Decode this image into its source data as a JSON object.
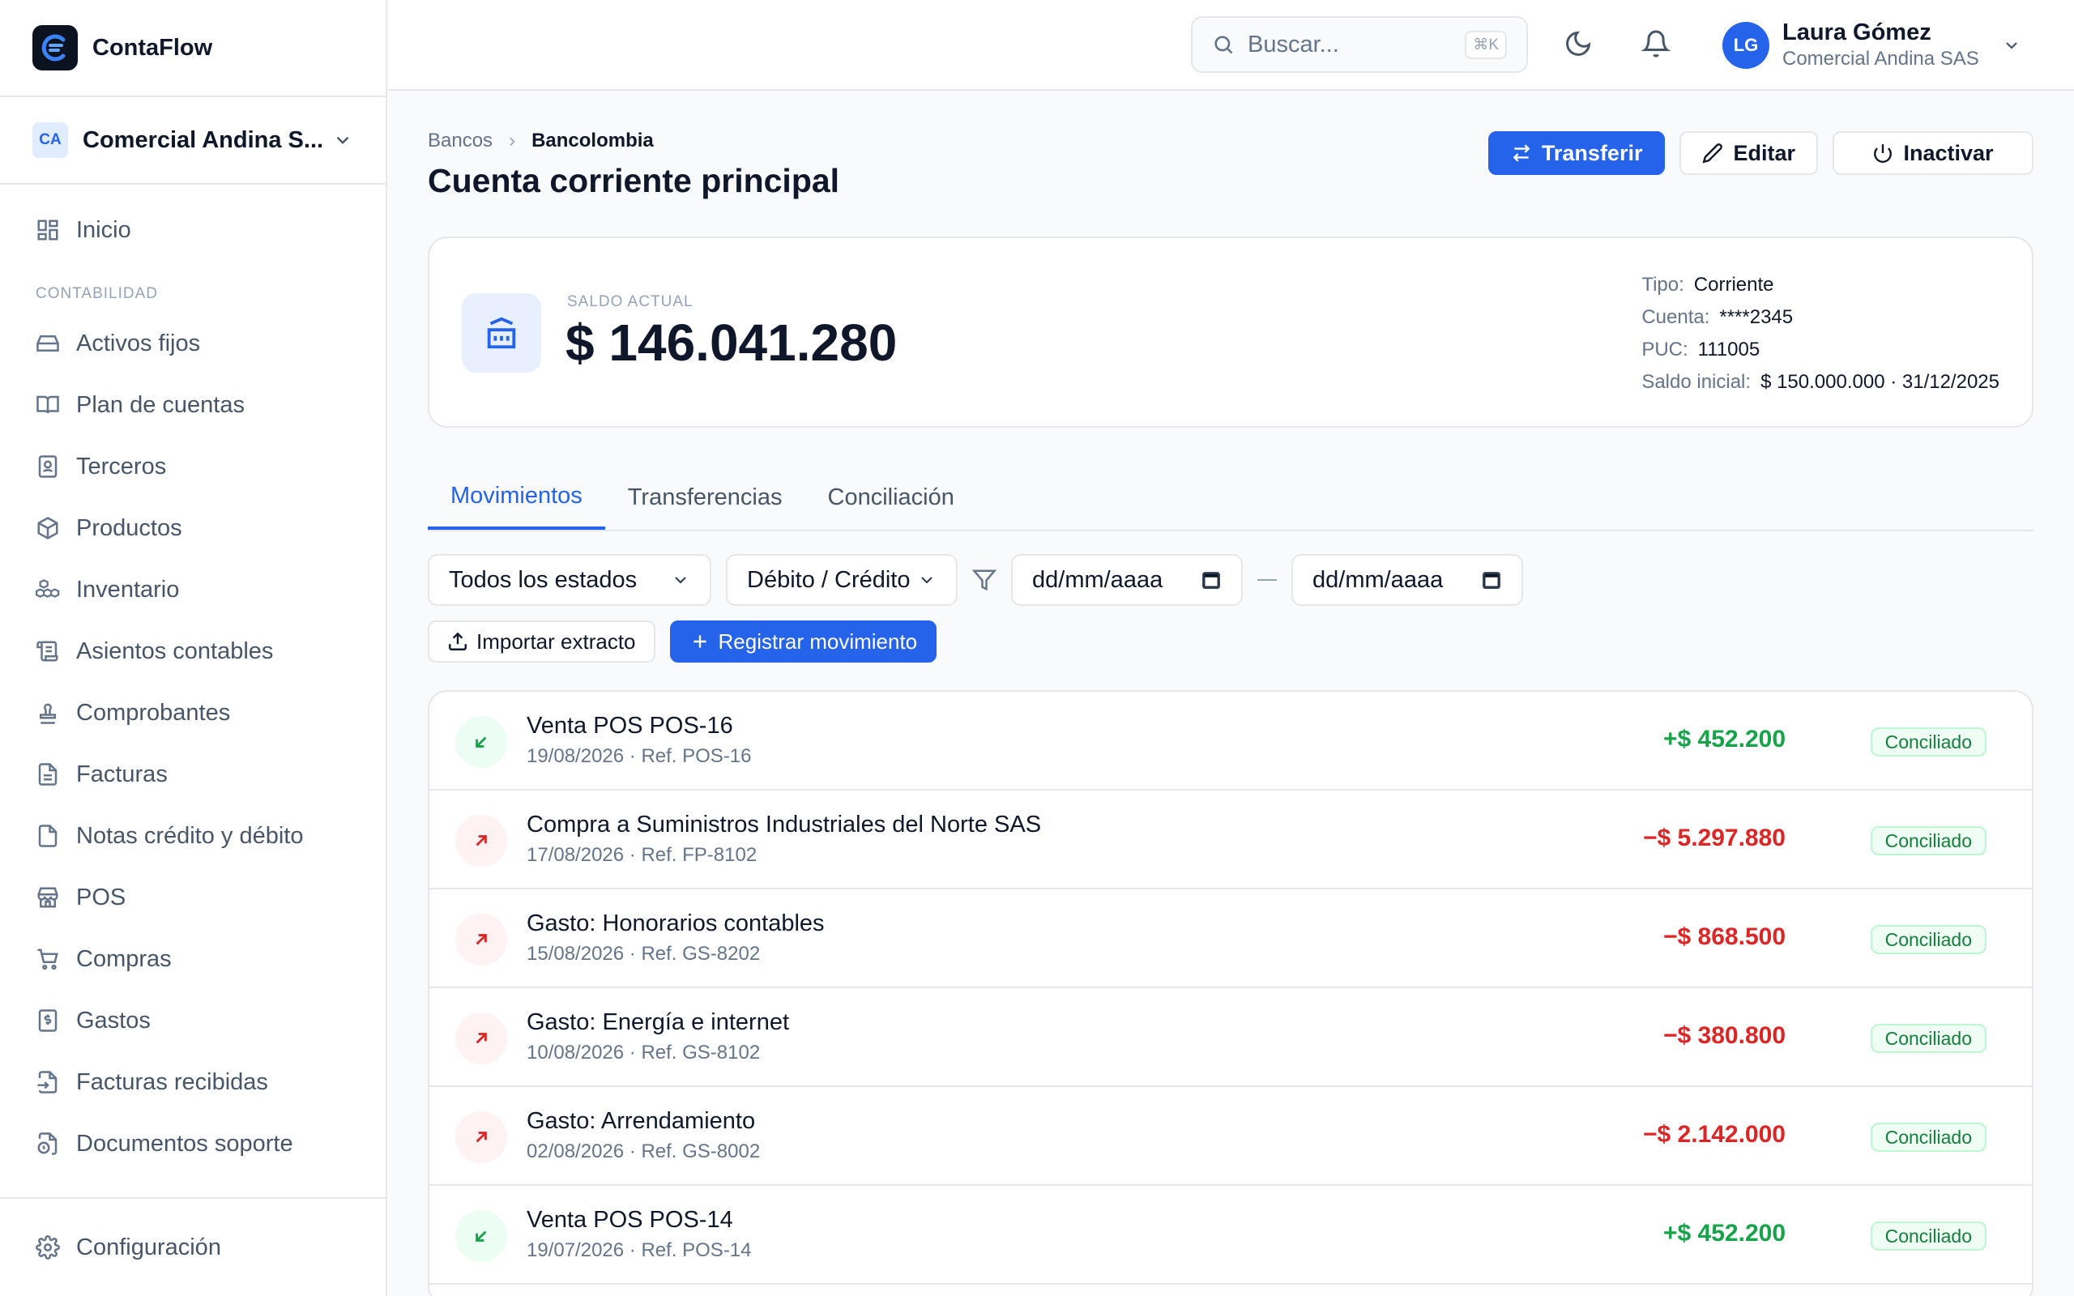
{
  "app": {
    "name": "ContaFlow",
    "company_initials": "CA",
    "company_name": "Comercial Andina S..."
  },
  "nav": {
    "home": "Inicio",
    "section": "CONTABILIDAD",
    "items": [
      "Activos fijos",
      "Plan de cuentas",
      "Terceros",
      "Productos",
      "Inventario",
      "Asientos contables",
      "Comprobantes",
      "Facturas",
      "Notas crédito y débito",
      "POS",
      "Compras",
      "Gastos",
      "Facturas recibidas",
      "Documentos soporte"
    ],
    "settings": "Configuración"
  },
  "header": {
    "search_placeholder": "Buscar...",
    "shortcut": "⌘K",
    "user_initials": "LG",
    "user_name": "Laura Gómez",
    "user_company": "Comercial Andina SAS"
  },
  "breadcrumb": {
    "parent": "Bancos",
    "current": "Bancolombia"
  },
  "page": {
    "title": "Cuenta corriente principal"
  },
  "actions": {
    "transfer": "Transferir",
    "edit": "Editar",
    "deactivate": "Inactivar"
  },
  "balance": {
    "label": "SALDO ACTUAL",
    "value": "$ 146.041.280",
    "type_label": "Tipo:",
    "type": "Corriente",
    "account_label": "Cuenta:",
    "account": "****2345",
    "puc_label": "PUC:",
    "puc": "111005",
    "initial_label": "Saldo inicial:",
    "initial": "$ 150.000.000 · 31/12/2025"
  },
  "tabs": [
    "Movimientos",
    "Transferencias",
    "Conciliación"
  ],
  "filters": {
    "status": "Todos los estados",
    "kind": "Débito / Crédito",
    "date_from": "dd/mm/aaaa",
    "date_to": "dd/mm/aaaa"
  },
  "toolbar": {
    "import": "Importar extracto",
    "register": "Registrar movimiento"
  },
  "movements": [
    {
      "title": "Venta POS POS-16",
      "sub": "19/08/2026 · Ref. POS-16",
      "amount": "+$ 452.200",
      "status": "Conciliado",
      "direction": "in"
    },
    {
      "title": "Compra a Suministros Industriales del Norte SAS",
      "sub": "17/08/2026 · Ref. FP-8102",
      "amount": "−$ 5.297.880",
      "status": "Conciliado",
      "direction": "out"
    },
    {
      "title": "Gasto: Honorarios contables",
      "sub": "15/08/2026 · Ref. GS-8202",
      "amount": "−$ 868.500",
      "status": "Conciliado",
      "direction": "out"
    },
    {
      "title": "Gasto: Energía e internet",
      "sub": "10/08/2026 · Ref. GS-8102",
      "amount": "−$ 380.800",
      "status": "Conciliado",
      "direction": "out"
    },
    {
      "title": "Gasto: Arrendamiento",
      "sub": "02/08/2026 · Ref. GS-8002",
      "amount": "−$ 2.142.000",
      "status": "Conciliado",
      "direction": "out"
    },
    {
      "title": "Venta POS POS-14",
      "sub": "19/07/2026 · Ref. POS-14",
      "amount": "+$ 452.200",
      "status": "Conciliado",
      "direction": "in"
    }
  ],
  "colors": {
    "accent": "#2563eb",
    "positive": "#16a34a",
    "negative": "#dc2626"
  }
}
